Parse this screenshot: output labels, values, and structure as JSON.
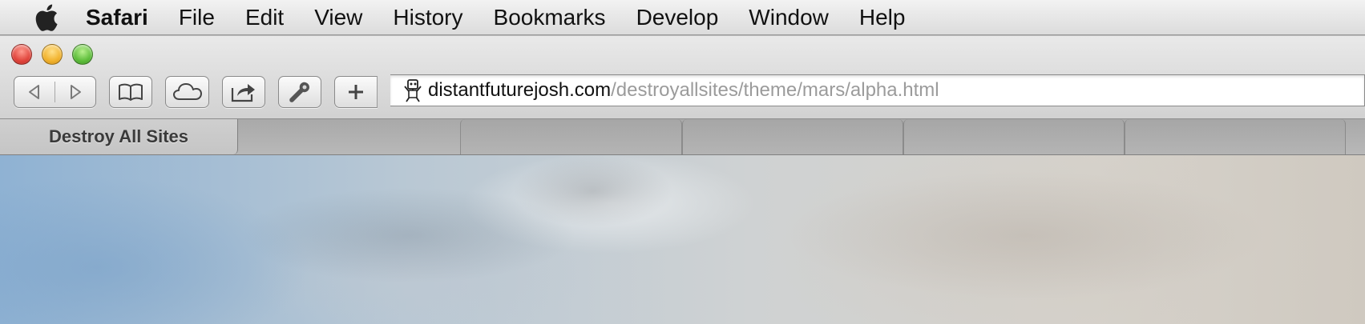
{
  "menubar": {
    "apple_icon": "apple-logo",
    "app_name": "Safari",
    "items": [
      "File",
      "Edit",
      "View",
      "History",
      "Bookmarks",
      "Develop",
      "Window",
      "Help"
    ]
  },
  "window": {
    "traffic_lights": {
      "close": "#e0443b",
      "minimize": "#f1b22c",
      "maximize": "#5dbd3a"
    },
    "toolbar": {
      "back_icon": "back-arrow-icon",
      "forward_icon": "forward-arrow-icon",
      "bookmarks_icon": "open-book-icon",
      "icloud_icon": "cloud-icon",
      "share_icon": "share-icon",
      "tools_icon": "wrench-icon",
      "new_tab_icon": "plus-icon"
    },
    "address": {
      "favicon": "robot-favicon",
      "host": "distantfuturejosh.com",
      "path": "/destroyallsites/theme/mars/alpha.html"
    }
  },
  "tabs": [
    {
      "label": "Destroy All Sites",
      "active": true
    },
    {
      "label": "",
      "active": false
    },
    {
      "label": "",
      "active": false
    },
    {
      "label": "",
      "active": false
    },
    {
      "label": "",
      "active": false
    }
  ]
}
